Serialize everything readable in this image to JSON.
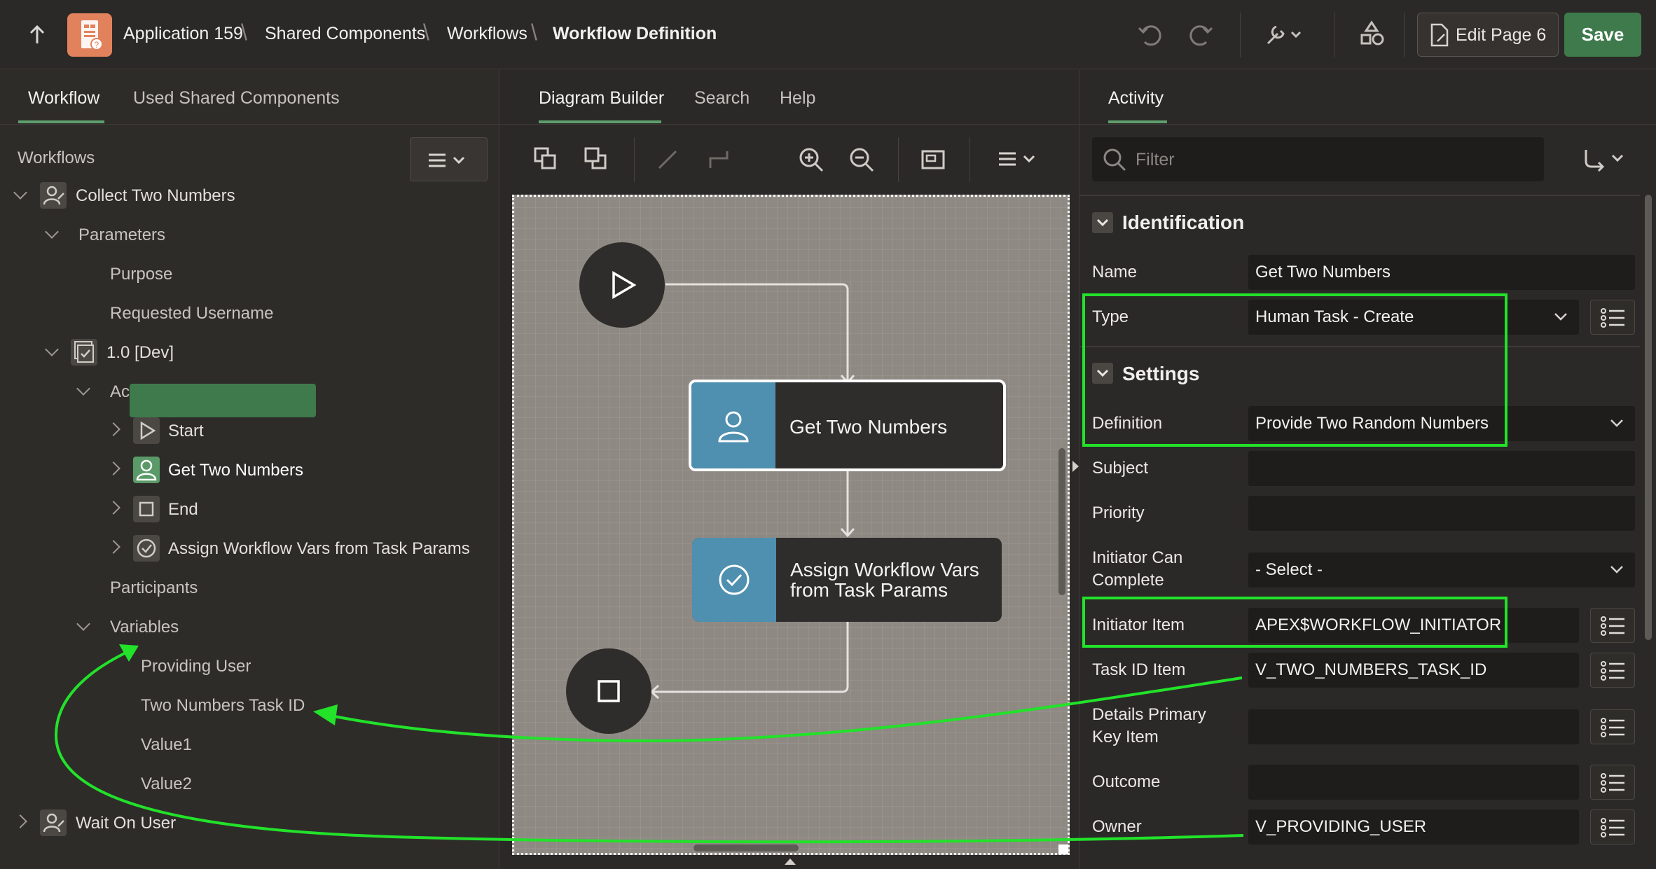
{
  "header": {
    "breadcrumb": [
      "Application 159",
      "Shared Components",
      "Workflows",
      "Workflow Definition"
    ],
    "edit_page": "Edit Page 6",
    "save": "Save"
  },
  "left_panel": {
    "tabs": [
      "Workflow",
      "Used Shared Components"
    ],
    "section_title": "Workflows",
    "tree": {
      "workflow": "Collect Two Numbers",
      "parameters": "Parameters",
      "param_items": [
        "Purpose",
        "Requested Username"
      ],
      "version": "1.0 [Dev]",
      "activities": "Activities",
      "activity_items": [
        "Start",
        "Get Two Numbers",
        "End",
        "Assign Workflow Vars from Task Params"
      ],
      "participants": "Participants",
      "variables": "Variables",
      "variable_items": [
        "Providing User",
        "Two Numbers Task ID",
        "Value1",
        "Value2"
      ],
      "workflow2": "Wait On User"
    }
  },
  "middle_panel": {
    "tabs": [
      "Diagram Builder",
      "Search",
      "Help"
    ],
    "nodes": {
      "task1": "Get Two Numbers",
      "task2_line1": "Assign Workflow Vars",
      "task2_line2": "from Task Params"
    }
  },
  "right_panel": {
    "tabs": [
      "Activity"
    ],
    "filter_placeholder": "Filter",
    "sections": {
      "identification": "Identification",
      "settings": "Settings"
    },
    "labels": {
      "name": "Name",
      "type": "Type",
      "definition": "Definition",
      "subject": "Subject",
      "priority": "Priority",
      "initiator_can_complete_1": "Initiator Can",
      "initiator_can_complete_2": "Complete",
      "initiator_item": "Initiator Item",
      "task_id_item": "Task ID Item",
      "details_pk_1": "Details Primary",
      "details_pk_2": "Key Item",
      "outcome": "Outcome",
      "owner": "Owner"
    },
    "values": {
      "name": "Get Two Numbers",
      "type": "Human Task - Create",
      "definition": "Provide Two Random Numbers",
      "subject": "",
      "priority": "",
      "initiator_can_complete": "- Select -",
      "initiator_item": "APEX$WORKFLOW_INITIATOR",
      "task_id_item": "V_TWO_NUMBERS_TASK_ID",
      "details_pk": "",
      "outcome": "",
      "owner": "V_PROVIDING_USER"
    }
  },
  "colors": {
    "accent_green": "#3e7a4b",
    "highlight_green": "#22e22a",
    "task_icon_blue": "#4f8fb0",
    "app_logo": "#e2825c"
  }
}
